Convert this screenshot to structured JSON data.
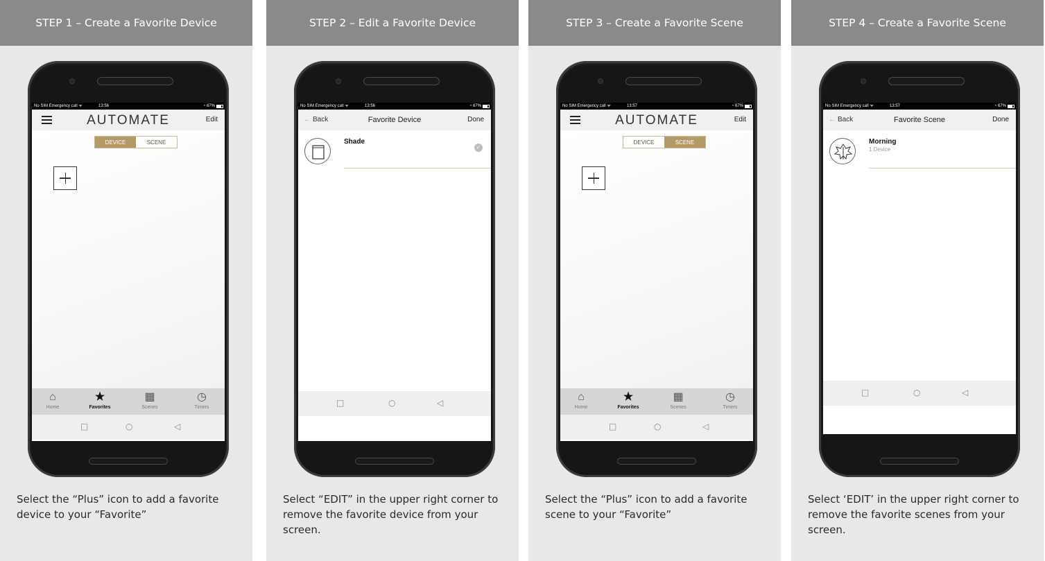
{
  "panels": [
    {
      "header": "STEP 1 – Create a Favorite Device",
      "caption": "Select the “Plus” icon to add a favorite device to your “Favorite”"
    },
    {
      "header": "STEP 2 – Edit a Favorite Device",
      "caption": "Select “EDIT” in the upper right corner to remove the favorite device from your screen."
    },
    {
      "header": "STEP 3 – Create a Favorite Scene",
      "caption": "Select the “Plus” icon to add a favorite scene to your “Favorite”"
    },
    {
      "header": "STEP 4 – Create a Favorite Scene",
      "caption": "Select ‘EDIT’ in the upper right corner to remove the favorite scenes from your screen."
    }
  ],
  "phones": [
    {
      "status": {
        "left": "No SIM  Emergency call ᯤ",
        "time": "13:56",
        "right": "◔ 67%"
      },
      "logo": "AUTOMATE",
      "edit": "Edit",
      "toggle": {
        "device": "DEVICE",
        "scene": "SCENE"
      },
      "tabs": {
        "home": "Home",
        "favorites": "Favorites",
        "scenes": "Scenes",
        "timers": "Timers"
      }
    },
    {
      "status": {
        "left": "No SIM  Emergency call ᯤ",
        "time": "13:56",
        "right": "◔ 67%"
      },
      "back": "Back",
      "title": "Favorite Device",
      "done": "Done",
      "item": {
        "name": "Shade"
      }
    },
    {
      "status": {
        "left": "No SIM  Emergency call ᯤ",
        "time": "13:57",
        "right": "◔ 67%"
      },
      "logo": "AUTOMATE",
      "edit": "Edit",
      "toggle": {
        "device": "DEVICE",
        "scene": "SCENE"
      },
      "tabs": {
        "home": "Home",
        "favorites": "Favorites",
        "scenes": "Scenes",
        "timers": "Timers"
      }
    },
    {
      "status": {
        "left": "No SIM  Emergency call ᯤ",
        "time": "13:57",
        "right": "◔ 67%"
      },
      "back": "Back",
      "title": "Favorite Scene",
      "done": "Done",
      "item": {
        "name": "Morning",
        "sub": "1 Device"
      }
    }
  ],
  "colors": {
    "accent": "#b39a68",
    "header_bg": "#8a8a8a",
    "panel_bg": "#e8e8e9"
  },
  "icons": [
    "hamburger-icon",
    "plus-icon",
    "home-icon",
    "star-icon",
    "film-icon",
    "clock-icon",
    "shade-icon",
    "scene-leaf-icon",
    "check-icon",
    "back-arrow-icon"
  ]
}
